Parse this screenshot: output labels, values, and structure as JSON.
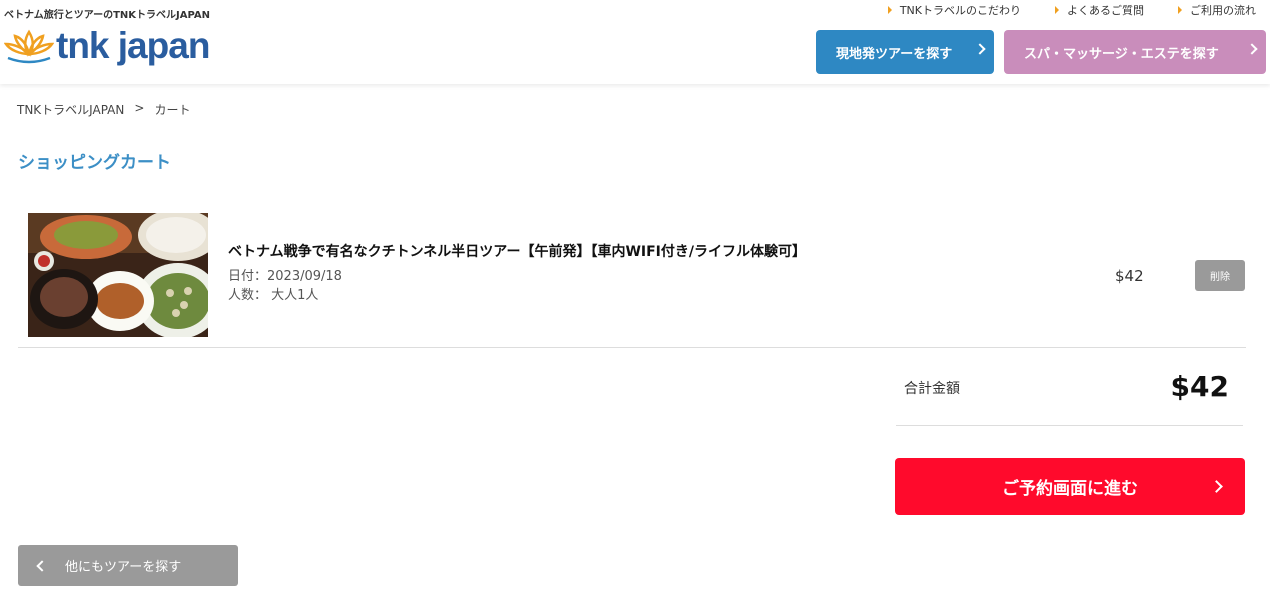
{
  "header": {
    "tagline": "ベトナム旅行とツアーのTNKトラベルJAPAN",
    "logo_text": "tnk japan",
    "top_links": [
      "TNKトラベルのこだわり",
      "よくあるご質問",
      "ご利用の流れ"
    ],
    "nav_tour_label": "現地発ツアーを探す",
    "nav_spa_label": "スパ・マッサージ・エステを探す",
    "colors": {
      "nav_tour": "#2e88c3",
      "nav_spa": "#c98dbb",
      "logo": "#2a5d9f",
      "lotus": "#f0a020"
    }
  },
  "breadcrumb": {
    "home": "TNKトラベルJAPAN",
    "separator": ">",
    "current": "カート"
  },
  "page_title": "ショッピングカート",
  "cart": {
    "items": [
      {
        "title": "ベトナム戦争で有名なクチトンネル半日ツアー【午前発】【車内WIFI付き/ライフル体験可】",
        "date": "日付：2023/09/18",
        "people": "人数： 大人1人",
        "price": "$42",
        "delete_label": "削除"
      }
    ],
    "total_label": "合計金額",
    "total_value": "$42"
  },
  "proceed_label": "ご予約画面に進む",
  "back_label": "他にもツアーを探す",
  "colors": {
    "accent_red": "#ff0a2c",
    "title_blue": "#3c8fc6",
    "gray_button": "#9a9a9a"
  }
}
